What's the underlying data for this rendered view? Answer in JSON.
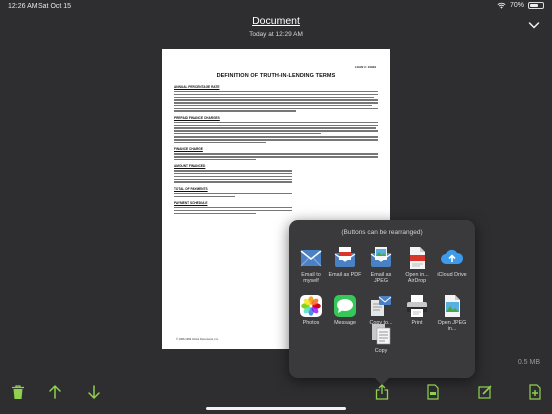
{
  "status_bar": {
    "time": "12:26 AM",
    "date": "Sat Oct 15",
    "battery": "70%",
    "battery_level": 0.7
  },
  "header": {
    "title": "Document",
    "subtitle": "Today at 12:29 AM"
  },
  "document": {
    "loan_number": "LOAN #: 10949",
    "heading": "DEFINITION OF TRUTH-IN-LENDING TERMS",
    "sections": [
      "ANNUAL PERCENTAGE RATE",
      "PREPAID FINANCE CHARGES",
      "FINANCE CHARGE",
      "AMOUNT FINANCED",
      "TOTAL OF PAYMENTS",
      "PAYMENT SCHEDULE"
    ],
    "footer": "© 1996-1999 Online Documents, Inc."
  },
  "file_size": "0.5 MB",
  "share_sheet": {
    "header": "(Buttons can be rearranged)",
    "items": [
      {
        "label": "Email to myself",
        "icon": "email-icon"
      },
      {
        "label": "Email as PDF",
        "icon": "email-pdf-icon"
      },
      {
        "label": "Email as JPEG",
        "icon": "email-jpeg-icon"
      },
      {
        "label": "Open in... AirDrop",
        "icon": "pdf-file-icon"
      },
      {
        "label": "iCloud Drive",
        "icon": "icloud-icon"
      },
      {
        "label": "Photos",
        "icon": "photos-icon"
      },
      {
        "label": "Message",
        "icon": "message-icon"
      },
      {
        "label": "Copy to...",
        "icon": "copy-to-icon"
      },
      {
        "label": "Print",
        "icon": "print-icon"
      },
      {
        "label": "Open JPEG in...",
        "icon": "jpeg-file-icon"
      },
      {
        "label": "Copy",
        "icon": "copy-icon"
      }
    ]
  },
  "toolbar": [
    "trash-icon",
    "arrow-up-icon",
    "arrow-down-icon",
    "share-icon",
    "pdf-icon",
    "edit-icon",
    "add-page-icon"
  ],
  "colors": {
    "accent": "#8fd14f",
    "background": "#2e2e30",
    "popover": "#3a3a3c"
  }
}
